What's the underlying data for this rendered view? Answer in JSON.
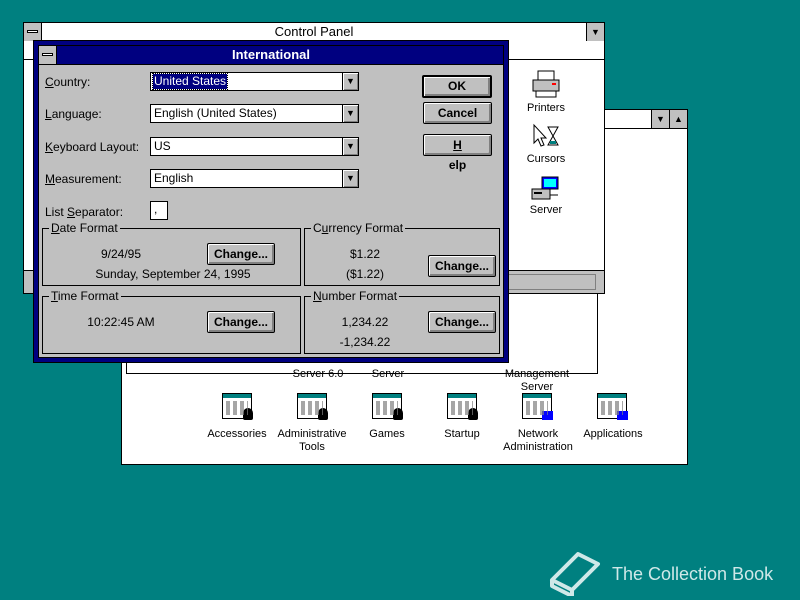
{
  "control_panel": {
    "title": "Control Panel",
    "icons": [
      {
        "label": "Printers",
        "icon": "printer-icon"
      },
      {
        "label": "Cursors",
        "icon": "cursor-icon"
      },
      {
        "label": "Server",
        "icon": "server-icon"
      }
    ]
  },
  "program_manager": {
    "partial_labels": [
      "Server 6.0",
      "Server",
      "Management",
      "Server"
    ],
    "groups": [
      {
        "label": "Accessories"
      },
      {
        "label": "Administrative",
        "label2": "Tools"
      },
      {
        "label": "Games"
      },
      {
        "label": "Startup"
      },
      {
        "label": "Network",
        "label2": "Administration"
      },
      {
        "label": "Applications"
      }
    ]
  },
  "dialog": {
    "title": "International",
    "fields": {
      "country": {
        "label_u": "C",
        "label_rest": "ountry:",
        "value": "United States"
      },
      "language": {
        "label_u": "L",
        "label_rest": "anguage:",
        "value": "English (United States)"
      },
      "keyboard": {
        "label_pre": "",
        "label_u": "K",
        "label_rest": "eyboard Layout:",
        "value": "US"
      },
      "measurement": {
        "label_u": "M",
        "label_rest": "easurement:",
        "value": "English"
      },
      "list_separator": {
        "label_pre": "List ",
        "label_u": "S",
        "label_rest": "eparator:",
        "value": ","
      }
    },
    "buttons": {
      "ok": "OK",
      "cancel": "Cancel",
      "help_u": "H",
      "help_rest": "elp"
    },
    "date_format": {
      "title_u": "D",
      "title_rest": "ate Format",
      "short": "9/24/95",
      "long": "Sunday, September 24, 1995",
      "change": "Change..."
    },
    "currency_format": {
      "title_pre": "C",
      "title_u": "u",
      "title_rest": "rrency Format",
      "positive": "$1.22",
      "negative": "($1.22)",
      "change": "Change..."
    },
    "time_format": {
      "title_u": "T",
      "title_rest": "ime Format",
      "value": "10:22:45 AM",
      "change": "Change..."
    },
    "number_format": {
      "title_u": "N",
      "title_rest": "umber Format",
      "positive": "1,234.22",
      "negative": "-1,234.22",
      "change": "Change..."
    }
  },
  "watermark": "The Collection Book"
}
